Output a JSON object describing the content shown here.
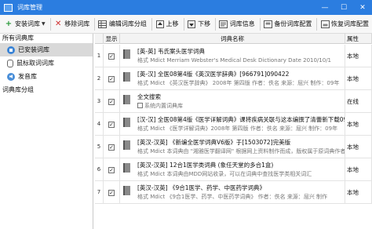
{
  "window": {
    "title": "词库管理",
    "minimize": "—",
    "maximize": "☐",
    "close": "✕"
  },
  "toolbar": {
    "install": "安装词库",
    "remove": "移除词库",
    "edit_group": "编辑词库分组",
    "up": "上移",
    "down": "下移",
    "info": "词库信息",
    "backup": "备份词库配置",
    "restore": "恢复词库配置"
  },
  "sidebar": {
    "header": "所有词典库",
    "items": [
      {
        "label": "已安装词库",
        "icon": "installed-icon"
      },
      {
        "label": "鼠标取词词库",
        "icon": "mouse-icon"
      },
      {
        "label": "发音库",
        "icon": "speaker-icon"
      }
    ],
    "group_header": "词典库分组"
  },
  "grid": {
    "columns": {
      "rownum": "",
      "show": "显示",
      "name": "词典名称",
      "attr": "属性"
    },
    "rows": [
      {
        "num": "1",
        "checked": true,
        "title": "[英-英] 韦氏案头医学词典",
        "sub": "格式 Mdict  Merriam Webster's Medical Desk Dictionary  Date 2010/10/1",
        "attr": "本地"
      },
      {
        "num": "2",
        "checked": true,
        "title": "[英-汉] 全医08第4版《英汉医学辞典》[966791]090422",
        "sub": "格式 Mdict 《英汉医学辞典》 2008年 第四版 作者：佚名 来源：屈兴 制作：09年",
        "attr": "本地"
      },
      {
        "num": "3",
        "checked": true,
        "title": "全文搜索",
        "sub": "系统内置词典库",
        "attr": "在线"
      },
      {
        "num": "4",
        "checked": true,
        "title": "[汉-汉] 全医08第4版《医学详解词典》课将疾病关联与这本编撰了清蕾新下载090419",
        "sub": "格式 Mdict 《医学详解词典》2008年 第四版 作者：佚名 来源：屈兴 制作：09年",
        "attr": "本地"
      },
      {
        "num": "5",
        "checked": true,
        "title": "[英汉-汉英] 《新编全医学词典V6版》于[1503072]完美版",
        "sub": "格式 Mdict  本词典由 \"湘雅医学翻译网\" 根据网上资料制作而成，版权属于原词典作者",
        "attr": "本地"
      },
      {
        "num": "6",
        "checked": true,
        "title": "[英汉-汉英] 12合1医学类词典 (象任天堂的多合1盒)",
        "sub": "格式 Mdict 本词典由MDD网站收录，可以在词典中查找医学类相关词汇",
        "attr": "本地"
      },
      {
        "num": "7",
        "checked": true,
        "title": "[英汉-汉英] 《9合1医学、药学、中医药学词典》",
        "sub": "格式 Mdict 《9合1医学、药学、中医药学词典》 作者：佚名 来源：屈兴 制作",
        "attr": "本地"
      }
    ]
  },
  "colors": {
    "titlebar": "#2b7de0",
    "selection": "#d9d9d9",
    "remove_icon": "#d03030",
    "add_icon": "#2a9a3a"
  }
}
